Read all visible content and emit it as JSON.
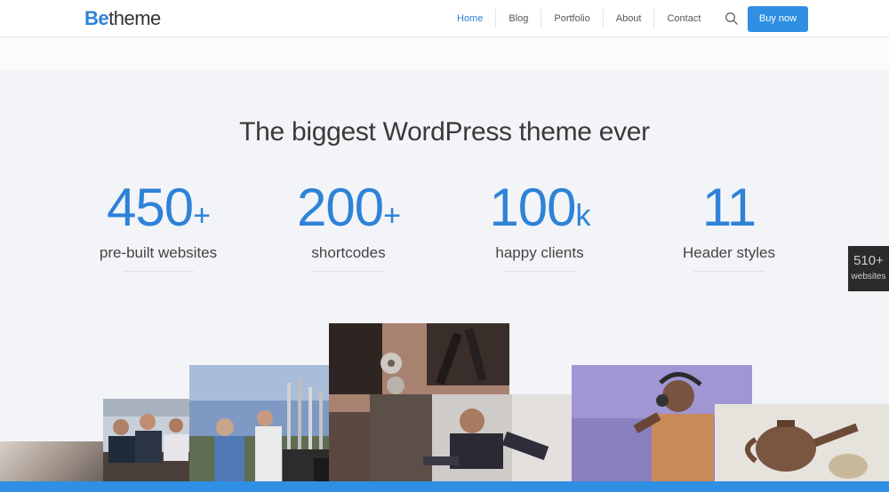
{
  "header": {
    "logo_be": "Be",
    "logo_theme": "theme",
    "nav": [
      {
        "label": "Home",
        "active": true
      },
      {
        "label": "Blog",
        "active": false
      },
      {
        "label": "Portfolio",
        "active": false
      },
      {
        "label": "About",
        "active": false
      },
      {
        "label": "Contact",
        "active": false
      }
    ],
    "search_icon": "search-icon",
    "buy_label": "Buy now"
  },
  "hero": {
    "headline": "The biggest WordPress theme ever",
    "stats": [
      {
        "number": "450",
        "suffix": "+",
        "label": "pre-built websites"
      },
      {
        "number": "200",
        "suffix": "+",
        "label": "shortcodes"
      },
      {
        "number": "100",
        "suffix": "k",
        "label": "happy clients"
      },
      {
        "number": "11",
        "suffix": "",
        "label": "Header styles"
      }
    ]
  },
  "side_badge": {
    "number": "510+",
    "label": "websites"
  },
  "colors": {
    "accent": "#2e82d8",
    "button": "#2e8fe3"
  }
}
